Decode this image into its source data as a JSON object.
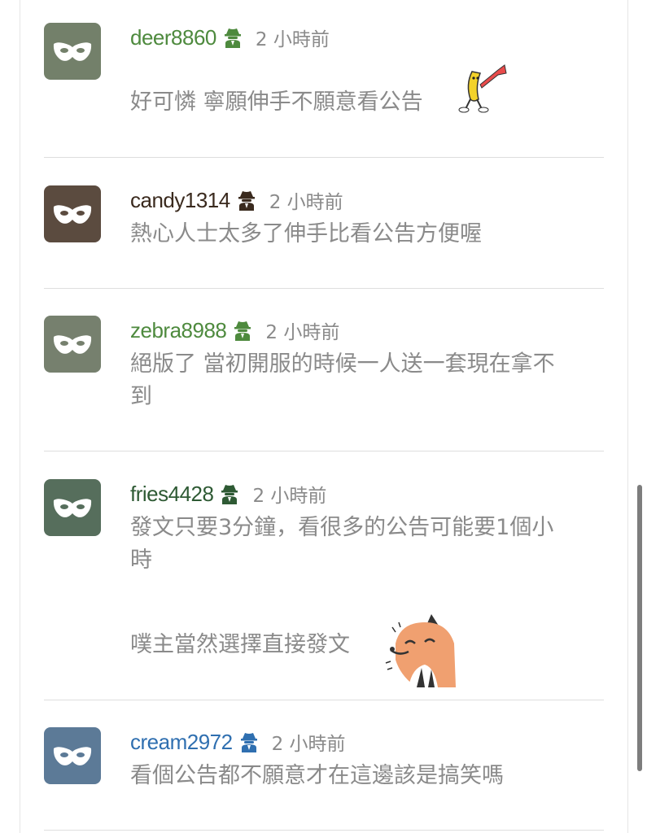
{
  "comments": [
    {
      "username": "deer8860",
      "time": "2 小時前",
      "name_color": "#4e8a3e",
      "avatar_color": "#73806a",
      "lines": [
        "好可憐 寧願伸手不願意看公告"
      ],
      "sticker": "banana-trumpet-sticker"
    },
    {
      "username": "candy1314",
      "time": "2 小時前",
      "name_color": "#3a2a1e",
      "avatar_color": "#5b4b3f",
      "lines": [
        "熱心人士太多了伸手比看公告方便喔"
      ]
    },
    {
      "username": "zebra8988",
      "time": "2 小時前",
      "name_color": "#4e8a3e",
      "avatar_color": "#76806e",
      "lines": [
        "絕版了 當初開服的時候一人送一套現在拿不",
        "到"
      ]
    },
    {
      "username": "fries4428",
      "time": "2 小時前",
      "name_color": "#2e5a34",
      "avatar_color": "#566e5c",
      "lines": [
        "發文只要3分鐘，看很多的公告可能要1個小",
        "時"
      ],
      "extra_line": "噗主當然選擇直接發文",
      "sticker": "laughing-fox-sticker"
    },
    {
      "username": "cream2972",
      "time": "2 小時前",
      "name_color": "#2f6fb0",
      "avatar_color": "#5c7a97",
      "lines": [
        "看個公告都不願意才在這邊該是搞笑嗎"
      ]
    }
  ],
  "icons": {
    "avatar": "mask-icon",
    "anonymous": "spy-icon"
  }
}
